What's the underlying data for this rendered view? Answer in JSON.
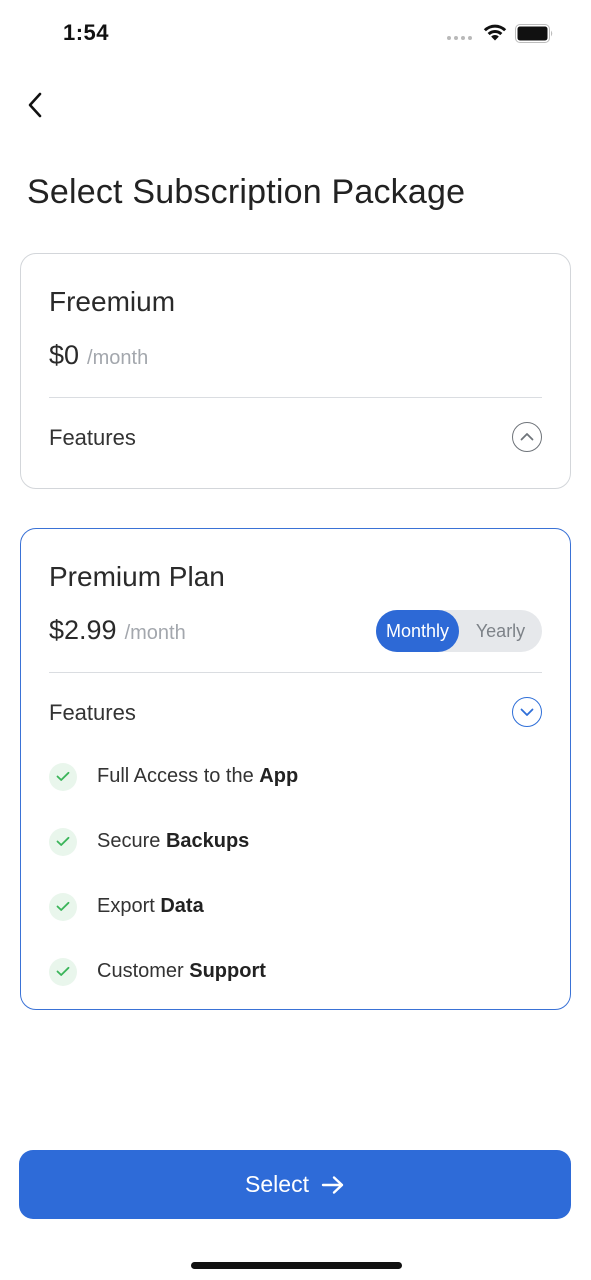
{
  "status_bar": {
    "time": "1:54"
  },
  "header": {
    "title": "Select Subscription Package"
  },
  "plans": [
    {
      "name": "Freemium",
      "price": "$0",
      "period": "/month",
      "features_label": "Features",
      "expanded": false
    },
    {
      "name": "Premium Plan",
      "price": "$2.99",
      "period": "/month",
      "features_label": "Features",
      "expanded": true,
      "billing_toggle": {
        "options": [
          "Monthly",
          "Yearly"
        ],
        "selected": "Monthly"
      },
      "features": [
        {
          "regular": "Full Access to the ",
          "bold": "App"
        },
        {
          "regular": "Secure ",
          "bold": "Backups"
        },
        {
          "regular": "Export ",
          "bold": "Data"
        },
        {
          "regular": "Customer ",
          "bold": "Support"
        }
      ]
    }
  ],
  "footer": {
    "select_label": "Select"
  },
  "colors": {
    "accent": "#2E6BD8",
    "check_green": "#3BB55A",
    "check_bg": "#E9F6EC",
    "border": "#D3D6DA"
  }
}
